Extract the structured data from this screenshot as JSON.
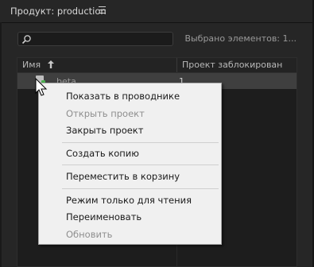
{
  "panel": {
    "title": "Продукт: production"
  },
  "search": {
    "placeholder": "",
    "selection_info": "Выбрано элементов: 1..."
  },
  "table": {
    "columns": {
      "name": "Имя",
      "locked": "Проект заблокирован"
    },
    "rows": [
      {
        "name": "beta",
        "locked": "1"
      }
    ]
  },
  "context_menu": {
    "items": [
      {
        "label": "Показать в проводнике",
        "enabled": true
      },
      {
        "label": "Открыть проект",
        "enabled": false
      },
      {
        "label": "Закрыть проект",
        "enabled": true
      },
      {
        "label": "Создать копию",
        "enabled": true
      },
      {
        "label": "Переместить в корзину",
        "enabled": true
      },
      {
        "label": "Режим только для чтения",
        "enabled": true
      },
      {
        "label": "Переименовать",
        "enabled": true
      },
      {
        "label": "Обновить",
        "enabled": false
      }
    ]
  },
  "colors": {
    "panel_bg": "#262626",
    "selected_row": "#3f3f3f",
    "menu_bg": "#f0f0f0",
    "status_green": "#4caf50"
  },
  "icons": [
    "panel-menu-icon",
    "search-icon",
    "sort-arrow-icon",
    "project-file-icon",
    "mouse-cursor-icon"
  ]
}
